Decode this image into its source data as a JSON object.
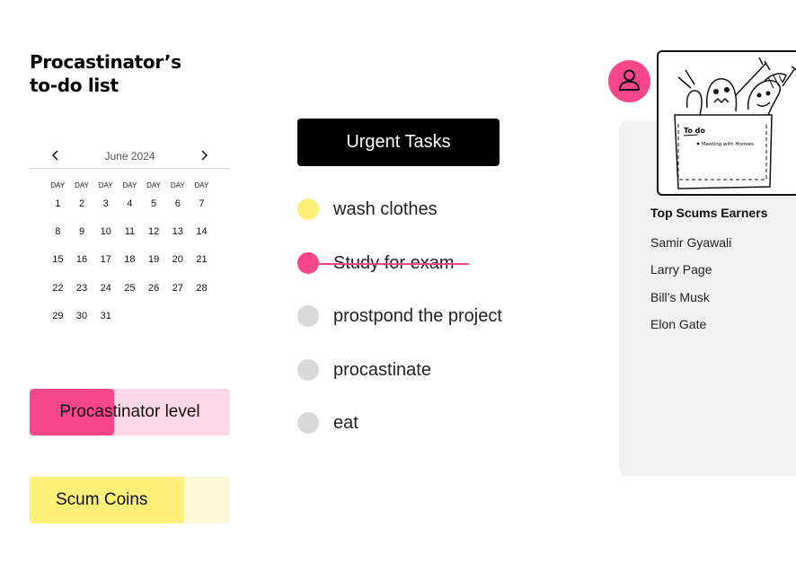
{
  "app": {
    "title_line1": "Procastinator’s",
    "title_line2": "to-do list"
  },
  "calendar": {
    "month_label": "June 2024",
    "weekday_labels": [
      "DAY",
      "DAY",
      "DAY",
      "DAY",
      "DAY",
      "DAY",
      "DAY"
    ],
    "days": [
      "1",
      "2",
      "3",
      "4",
      "5",
      "6",
      "7",
      "8",
      "9",
      "10",
      "11",
      "12",
      "13",
      "14",
      "15",
      "16",
      "17",
      "18",
      "19",
      "20",
      "21",
      "22",
      "23",
      "24",
      "25",
      "26",
      "27",
      "28",
      "29",
      "30",
      "31"
    ]
  },
  "procrastinator_level": {
    "label": "Procastinator level",
    "fraction": 0.42,
    "colors": {
      "fill": "#f7468a",
      "track": "#ffd7e6"
    }
  },
  "scum_coins": {
    "label": "Scum Coins",
    "fraction": 0.77,
    "colors": {
      "fill": "#fff07a",
      "track": "#fff8d9"
    }
  },
  "urgent_button_label": "Urgent Tasks",
  "tasks": [
    {
      "label": "wash clothes",
      "status": "urgent",
      "dot_color": "#fff07a"
    },
    {
      "label": "Study for exam",
      "status": "done",
      "dot_color": "#f7468a"
    },
    {
      "label": "prostpond the project",
      "status": "todo",
      "dot_color": "#d9d9d9"
    },
    {
      "label": "procastinate",
      "status": "todo",
      "dot_color": "#d9d9d9"
    },
    {
      "label": "eat",
      "status": "todo",
      "dot_color": "#d9d9d9"
    }
  ],
  "profile": {
    "avatar_icon": "user-icon",
    "accent": "#f7468a"
  },
  "sketch": {
    "todo_text": "To do",
    "note_text": "Meeting with Homies"
  },
  "earners": {
    "title": "Top Scums Earners",
    "names": [
      "Samir Gyawali",
      "Larry Page",
      "Bill’s Musk",
      "Elon Gate"
    ]
  }
}
